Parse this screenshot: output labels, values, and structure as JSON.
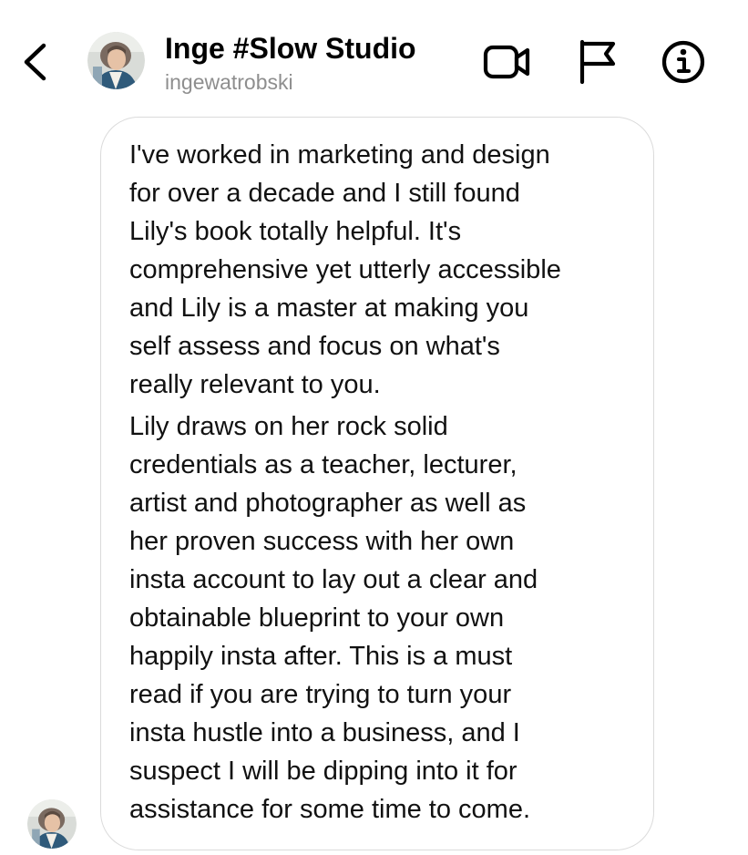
{
  "header": {
    "contact_name": "Inge #Slow Studio",
    "contact_username": "ingewatrobski",
    "icons": [
      "back-chevron-icon",
      "video-camera-icon",
      "flag-icon",
      "info-icon"
    ]
  },
  "conversation": {
    "messages": [
      {
        "sender": "ingewatrobski",
        "paragraphs": [
          "I've worked in marketing and design\nfor over a decade and I still found\nLily's book totally helpful. It's\ncomprehensive yet utterly accessible\nand Lily is a master at making you\nself assess and focus on what's\nreally relevant to you.",
          "Lily draws on her rock solid\ncredentials as a teacher, lecturer,\nartist and photographer as well as\nher proven success with her own\ninsta account to lay out a clear and\nobtainable blueprint to your own\nhappily insta after. This is a must\nread if you are trying to turn your\ninsta hustle into a business, and I\nsuspect I will be dipping into it for\nassistance for some time to come."
        ]
      }
    ]
  },
  "colors": {
    "text": "#111111",
    "secondary_text": "#8e8e8e",
    "bubble_border": "#dbdbdb",
    "background": "#ffffff"
  }
}
